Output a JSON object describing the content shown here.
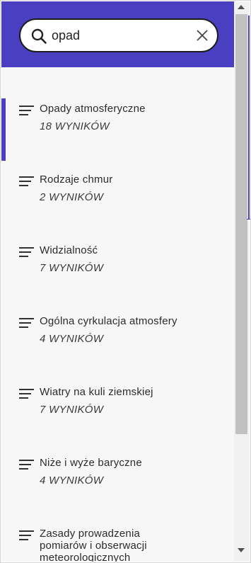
{
  "search": {
    "value": "opad",
    "icons": {
      "search": "search-icon",
      "clear": "close-icon"
    }
  },
  "results": [
    {
      "title": "Opady atmosferyczne",
      "count": "18 WYNIKÓW",
      "active": true
    },
    {
      "title": "Rodzaje chmur",
      "count": "2 WYNIKÓW",
      "active": false
    },
    {
      "title": "Widzialność",
      "count": "7 WYNIKÓW",
      "active": false
    },
    {
      "title": "Ogólna cyrkulacja atmosfery",
      "count": "4 WYNIKÓW",
      "active": false
    },
    {
      "title": "Wiatry na kuli ziemskiej",
      "count": "7 WYNIKÓW",
      "active": false
    },
    {
      "title": "Niże i wyże baryczne",
      "count": "4 WYNIKÓW",
      "active": false
    },
    {
      "title": "Zasady prowadzenia pomiarów i obserwacji meteorologicznych",
      "count": "",
      "active": false
    }
  ],
  "colors": {
    "accent": "#4a3fc0",
    "list_bg": "#f7f7f7",
    "text": "#2b2b2b"
  }
}
